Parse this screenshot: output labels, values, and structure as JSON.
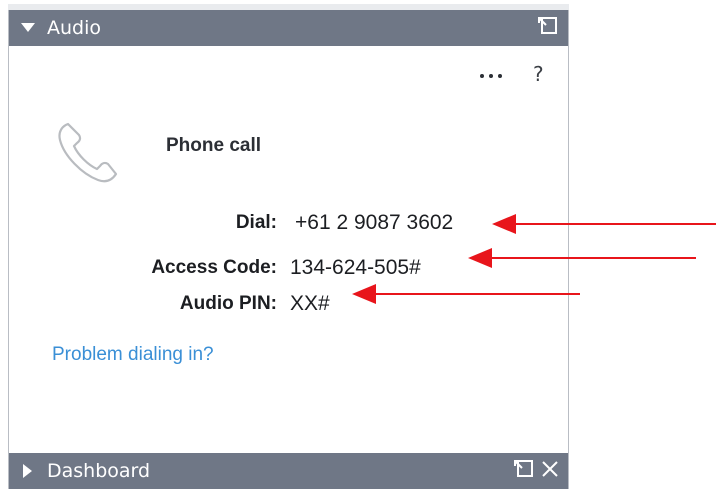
{
  "audio_panel": {
    "title": "Audio",
    "more_icon": "more-horizontal-icon",
    "help_label": "?",
    "phone_title": "Phone call",
    "details": [
      {
        "label": "Dial:",
        "value": "+61 2 9087 3602"
      },
      {
        "label": "Access Code:",
        "value": "134-624-505#"
      },
      {
        "label": "Audio PIN:",
        "value": "XX#"
      }
    ],
    "problem_link": "Problem dialing in?"
  },
  "dashboard_panel": {
    "title": "Dashboard"
  },
  "colors": {
    "titlebar": "#6f7786",
    "link": "#3a8fd6",
    "annotation_arrow": "#e8151b"
  }
}
